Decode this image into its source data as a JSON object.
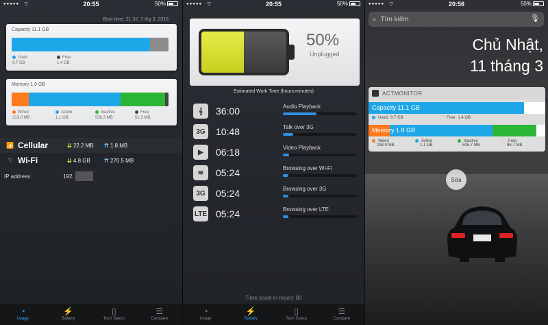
{
  "status": [
    {
      "time": "20:55",
      "battery": "50%"
    },
    {
      "time": "20:55",
      "battery": "50%"
    },
    {
      "time": "20:56",
      "battery": "50%"
    }
  ],
  "usage": {
    "boot_time": "Boot time: 21:32, 7 thg 3, 2018",
    "capacity": {
      "title": "Capacity 11.1 GB",
      "used_fraction": 0.88,
      "legend": [
        {
          "label": "Used",
          "value": "9.7 GB",
          "color": "#1ea7e8"
        },
        {
          "label": "Free",
          "value": "1.4 GB",
          "color": "#444444"
        }
      ]
    },
    "memory": {
      "title": "Memory 1.9 GB",
      "segments": [
        {
          "label": "Wired",
          "value": "213.0 MB",
          "color": "#ff7a1a",
          "fraction": 0.11
        },
        {
          "label": "Active",
          "value": "1.1 GB",
          "color": "#1ea7e8",
          "fraction": 0.59
        },
        {
          "label": "Inactive",
          "value": "556.3 MB",
          "color": "#2bb534",
          "fraction": 0.29
        },
        {
          "label": "Free",
          "value": "51.3 MB",
          "color": "#444444",
          "fraction": 0.02
        }
      ]
    },
    "network": [
      {
        "icon": "cellular-icon",
        "label": "Cellular",
        "download": "22.2 MB",
        "upload": "1.8 MB"
      },
      {
        "icon": "wifi-icon",
        "label": "Wi-Fi",
        "download": "4.8 GB",
        "upload": "270.5 MB"
      }
    ],
    "ip_label": "IP address",
    "ip_value": "192."
  },
  "battery": {
    "percent": "50%",
    "level": 0.5,
    "state": "Unplugged",
    "heading": "Estimated Work Time (hours:minutes)",
    "rows": [
      {
        "icon": "music-icon",
        "glyph": "𝄞",
        "time": "36:00",
        "label": "Audio Playback",
        "fraction": 0.45
      },
      {
        "icon": "phone-3g-icon",
        "glyph": "3G",
        "time": "10:48",
        "label": "Talk over 3G",
        "fraction": 0.14
      },
      {
        "icon": "video-icon",
        "glyph": "▶",
        "time": "06:18",
        "label": "Video Playback",
        "fraction": 0.08
      },
      {
        "icon": "wifi-icon",
        "glyph": "≋",
        "time": "05:24",
        "label": "Browsing over Wi-Fi",
        "fraction": 0.07
      },
      {
        "icon": "3g-icon",
        "glyph": "3G",
        "time": "05:24",
        "label": "Browsing over 3G",
        "fraction": 0.07
      },
      {
        "icon": "lte-icon",
        "glyph": "LTE",
        "time": "05:24",
        "label": "Browsing over LTE",
        "fraction": 0.07
      }
    ],
    "time_scale": "Time scale in hours: 80"
  },
  "tabs": [
    {
      "label": "Usage",
      "icon": "pie-chart-icon",
      "glyph": "◔"
    },
    {
      "label": "Battery",
      "icon": "lightning-icon",
      "glyph": "⚡"
    },
    {
      "label": "Tech Specs",
      "icon": "phone-icon",
      "glyph": "▯"
    },
    {
      "label": "Compare",
      "icon": "compare-icon",
      "glyph": "☰"
    }
  ],
  "lockscreen": {
    "search_placeholder": "Tìm kiếm",
    "day": "Chủ Nhật,",
    "date": "11 tháng 3",
    "widget_name": "ACTMONITOR",
    "capacity": {
      "title": "Capacity 11.1 GB",
      "used_fraction": 0.88,
      "legend": [
        {
          "label": "Used",
          "value": "9.7 GB",
          "color": "#1ea7e8"
        },
        {
          "label": "Free",
          "value": "1.4 GB",
          "color": "#ffffff"
        }
      ]
    },
    "memory": {
      "title": "Memory 1.9 GB",
      "segments": [
        {
          "label": "Wired",
          "value": "238.9 MB",
          "color": "#ff7a1a",
          "fraction": 0.12
        },
        {
          "label": "Active",
          "value": "1.1 GB",
          "color": "#1ea7e8",
          "fraction": 0.58
        },
        {
          "label": "Inactive",
          "value": "505.7 MB",
          "color": "#2bb534",
          "fraction": 0.25
        },
        {
          "label": "Free",
          "value": "86.7 MB",
          "color": "#ffffff",
          "fraction": 0.05
        }
      ]
    },
    "edit_label": "Sửa"
  }
}
